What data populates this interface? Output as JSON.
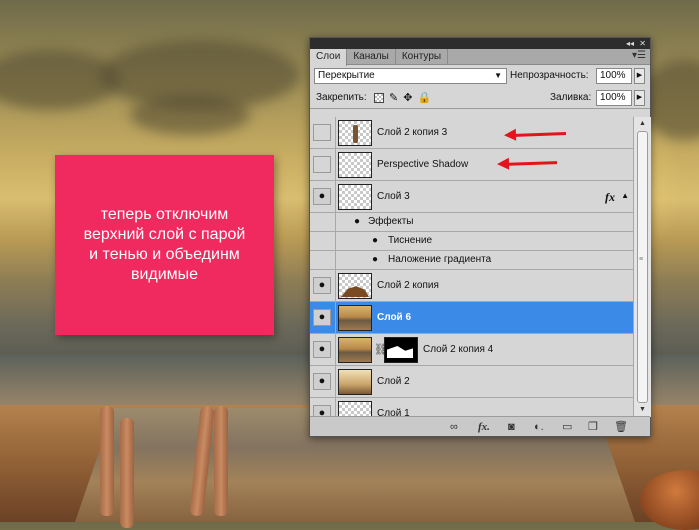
{
  "note": {
    "text": "теперь отключим\nверхний слой с парой\nи тенью и объединм\nвидимые"
  },
  "panel": {
    "title_controls": {
      "collapse": "◂◂",
      "close": "✕"
    },
    "tabs": [
      {
        "label": "Слои",
        "active": true
      },
      {
        "label": "Каналы",
        "active": false
      },
      {
        "label": "Контуры",
        "active": false
      }
    ],
    "menu_icon": "panel-menu-icon",
    "blend_mode": "Перекрытие",
    "opacity_label": "Непрозрачность:",
    "opacity_value": "100%",
    "lock_label": "Закрепить:",
    "fill_label": "Заливка:",
    "fill_value": "100%",
    "layers": [
      {
        "name": "Слой 2 копия 3",
        "visible": false,
        "thumb": "figure"
      },
      {
        "name": "Perspective Shadow",
        "visible": false,
        "thumb": "transparent"
      },
      {
        "name": "Слой 3",
        "visible": true,
        "thumb": "transparent",
        "fx": "fx"
      },
      {
        "name": "Эффекты",
        "type": "effects-header"
      },
      {
        "name": "Тиснение",
        "type": "effect"
      },
      {
        "name": "Наложение градиента",
        "type": "effect"
      },
      {
        "name": "Слой 2 копия",
        "visible": true,
        "thumb": "hill"
      },
      {
        "name": "Слой 6",
        "visible": true,
        "thumb": "photo",
        "selected": true
      },
      {
        "name": "Слой 2 копия 4",
        "visible": true,
        "thumb": "photo",
        "mask": true
      },
      {
        "name": "Слой 2",
        "visible": true,
        "thumb": "gradient"
      },
      {
        "name": "Слой 1",
        "visible": true,
        "thumb": "transparent"
      }
    ],
    "footer_icons": [
      "link-icon",
      "fx-icon",
      "mask-icon",
      "adjustment-icon",
      "group-icon",
      "new-layer-icon",
      "trash-icon"
    ]
  },
  "colors": {
    "note_bg": "#f0295f",
    "selection": "#3c8ae8",
    "arrow": "#e3141b"
  }
}
